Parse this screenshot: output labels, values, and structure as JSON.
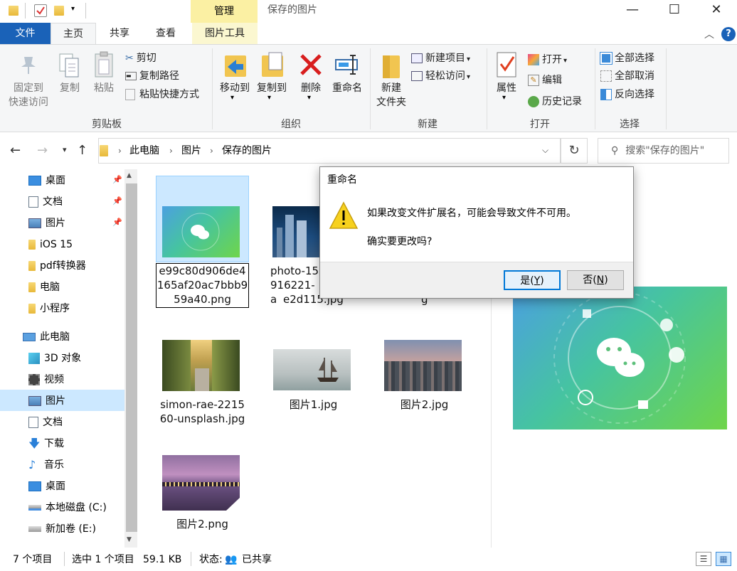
{
  "window": {
    "title": "保存的图片",
    "context_tab": "管理",
    "minimize": "—",
    "maximize": "☐",
    "close": "✕"
  },
  "ribbon_tabs": {
    "file": "文件",
    "home": "主页",
    "share": "共享",
    "view": "查看",
    "picture_tools": "图片工具"
  },
  "ribbon": {
    "clipboard": {
      "label": "剪贴板",
      "pin_line1": "固定到",
      "pin_line2": "快速访问",
      "copy": "复制",
      "paste": "粘贴",
      "cut": "剪切",
      "copy_path": "复制路径",
      "paste_shortcut": "粘贴快捷方式"
    },
    "organize": {
      "label": "组织",
      "move_to": "移动到",
      "copy_to": "复制到",
      "delete": "删除",
      "rename": "重命名"
    },
    "new": {
      "label": "新建",
      "new_folder_line1": "新建",
      "new_folder_line2": "文件夹",
      "new_item": "新建项目",
      "easy_access": "轻松访问"
    },
    "open": {
      "label": "打开",
      "properties": "属性",
      "open": "打开",
      "edit": "编辑",
      "history": "历史记录"
    },
    "select": {
      "label": "选择",
      "select_all": "全部选择",
      "select_none": "全部取消",
      "invert": "反向选择"
    }
  },
  "address": {
    "crumbs": [
      "此电脑",
      "图片",
      "保存的图片"
    ],
    "search_placeholder": "搜索\"保存的图片\""
  },
  "nav_pane": {
    "quick": [
      {
        "label": "桌面",
        "pinned": true
      },
      {
        "label": "文档",
        "pinned": true
      },
      {
        "label": "图片",
        "pinned": true
      },
      {
        "label": "iOS 15"
      },
      {
        "label": "pdf转换器"
      },
      {
        "label": "电脑"
      },
      {
        "label": "小程序"
      }
    ],
    "this_pc": "此电脑",
    "pc_items": [
      "3D 对象",
      "视频",
      "图片",
      "文档",
      "下载",
      "音乐",
      "桌面",
      "本地磁盘 (C:)",
      "新加卷 (E:)"
    ],
    "selected": "图片"
  },
  "files": [
    {
      "name": "e99c80d906de4165af20ac7bbb959a40.png",
      "line1": "e99c80d906de4",
      "line2": "165af20ac7bbb9",
      "line3": "59a40.png",
      "renaming": true
    },
    {
      "name": "photo-15…916221-a…e2d115.jpg",
      "line1": "photo-15",
      "line2": "916221-a",
      "line3": "e2d115.jpg"
    },
    {
      "name": "…g",
      "line1": "g"
    },
    {
      "name": "simon-rae-221560-unsplash.jpg",
      "line1": "simon-rae-2215",
      "line2": "60-unsplash.jpg"
    },
    {
      "name": "图片1.jpg",
      "line1": "图片1.jpg"
    },
    {
      "name": "图片2.jpg",
      "line1": "图片2.jpg"
    },
    {
      "name": "图片2.png",
      "line1": "图片2.png"
    }
  ],
  "dialog": {
    "title": "重命名",
    "message": "如果改变文件扩展名，可能会导致文件不可用。",
    "question": "确实要更改吗?",
    "yes_label": "是",
    "yes_key": "Y",
    "no_label": "否",
    "no_key": "N"
  },
  "status": {
    "count": "7 个项目",
    "selected": "选中 1 个项目",
    "size": "59.1 KB",
    "state_label": "状态:",
    "state_value": "已共享"
  },
  "colors": {
    "accent": "#1a62b8",
    "context_tab": "#fbf0a3",
    "selection": "#cce8ff",
    "wechat_gradient_start": "#4ba0e0",
    "wechat_gradient_end": "#6fd54a"
  }
}
